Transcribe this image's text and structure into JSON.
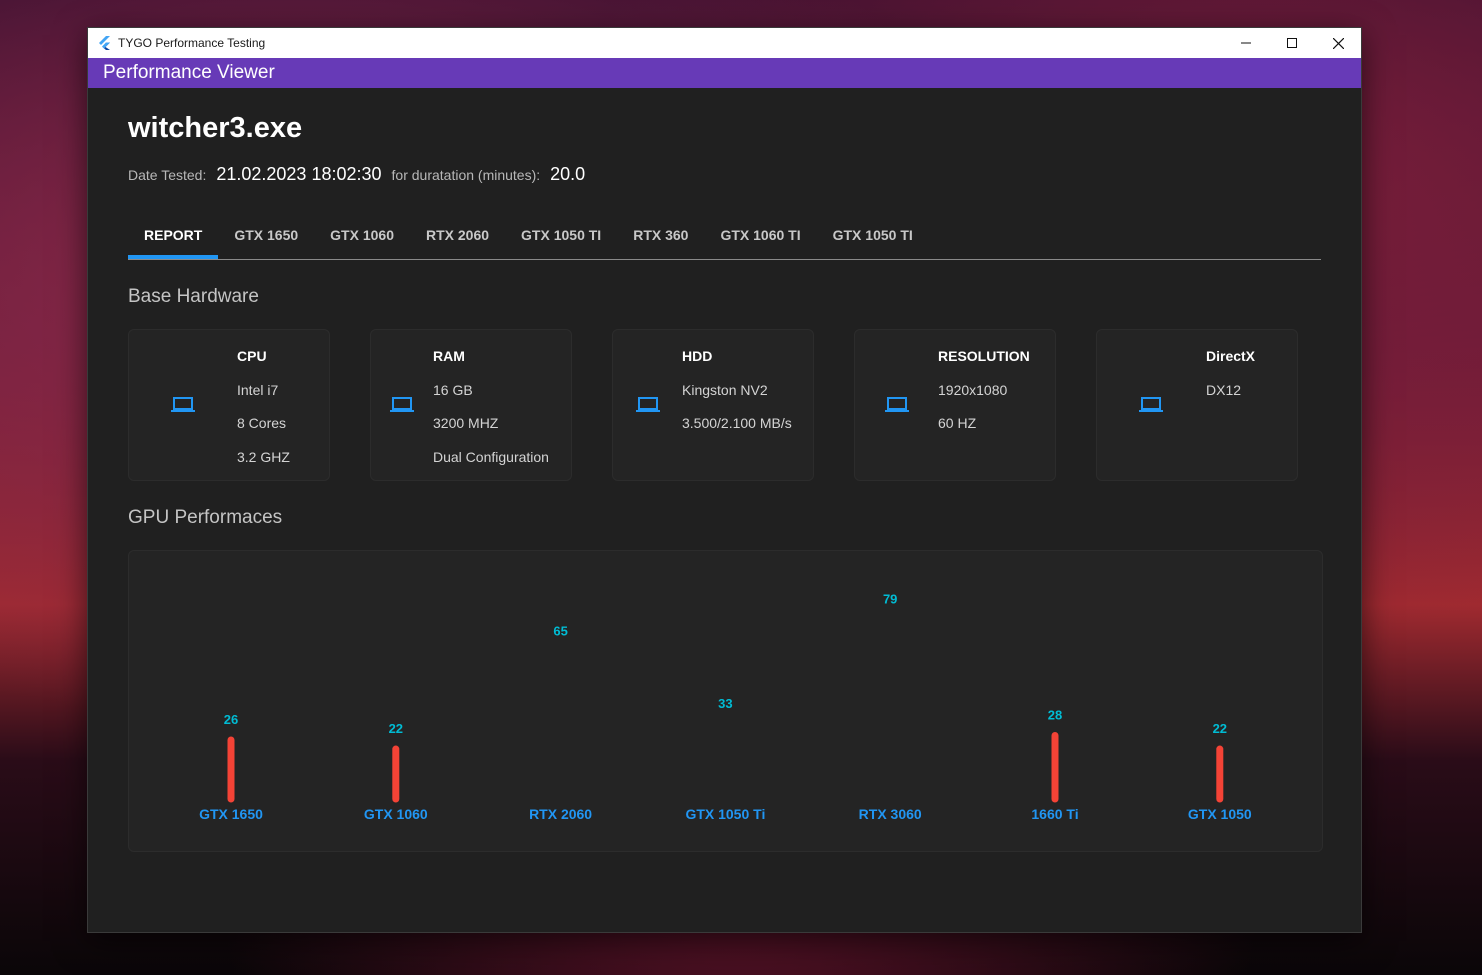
{
  "window": {
    "title": "TYGO Performance Testing"
  },
  "appbar": {
    "title": "Performance Viewer"
  },
  "header": {
    "exe": "witcher3.exe",
    "date_label": "Date Tested:",
    "date_value": "21.02.2023 18:02:30",
    "duration_label": "for duratation (minutes):",
    "duration_value": "20.0"
  },
  "tabs": [
    "REPORT",
    "GTX 1650",
    "GTX 1060",
    "RTX 2060",
    "GTX 1050 TI",
    "RTX 360",
    "GTX 1060 TI",
    "GTX 1050 TI"
  ],
  "sections": {
    "hardware": "Base Hardware",
    "gpu": "GPU Performaces"
  },
  "hardware": [
    {
      "icon": "laptop-icon",
      "title": "CPU",
      "lines": [
        "Intel i7",
        "8 Cores",
        "3.2 GHZ"
      ]
    },
    {
      "icon": "laptop-icon",
      "title": "RAM",
      "lines": [
        "16 GB",
        "3200 MHZ",
        "Dual Configuration"
      ]
    },
    {
      "icon": "laptop-icon",
      "title": "HDD",
      "lines": [
        "Kingston NV2",
        "3.500/2.100 MB/s"
      ]
    },
    {
      "icon": "laptop-icon",
      "title": "RESOLUTION",
      "lines": [
        "1920x1080",
        "60 HZ"
      ]
    },
    {
      "icon": "laptop-icon",
      "title": "DirectX",
      "lines": [
        "DX12"
      ]
    }
  ],
  "colors": {
    "accent": "#2196f3",
    "appbar": "#673ab7",
    "bar_low": "#f44336",
    "bar_high_top": "#00bcd4",
    "bar_high_bottom": "#2196f3",
    "label": "#2196f3",
    "value": "#00bcd4"
  },
  "chart_data": {
    "type": "bar",
    "categories": [
      "GTX 1650",
      "GTX 1060",
      "RTX 2060",
      "GTX 1050 Ti",
      "RTX 3060",
      "1660 Ti",
      "GTX 1050"
    ],
    "values": [
      26,
      22,
      65,
      33,
      79,
      28,
      22
    ],
    "bar_colors": [
      "#f44336",
      "#f44336",
      "gradient",
      "gradient",
      "gradient",
      "#f44336",
      "#f44336"
    ],
    "title": "",
    "xlabel": "",
    "ylabel": "",
    "ylim": [
      0,
      80
    ],
    "grid": false
  }
}
